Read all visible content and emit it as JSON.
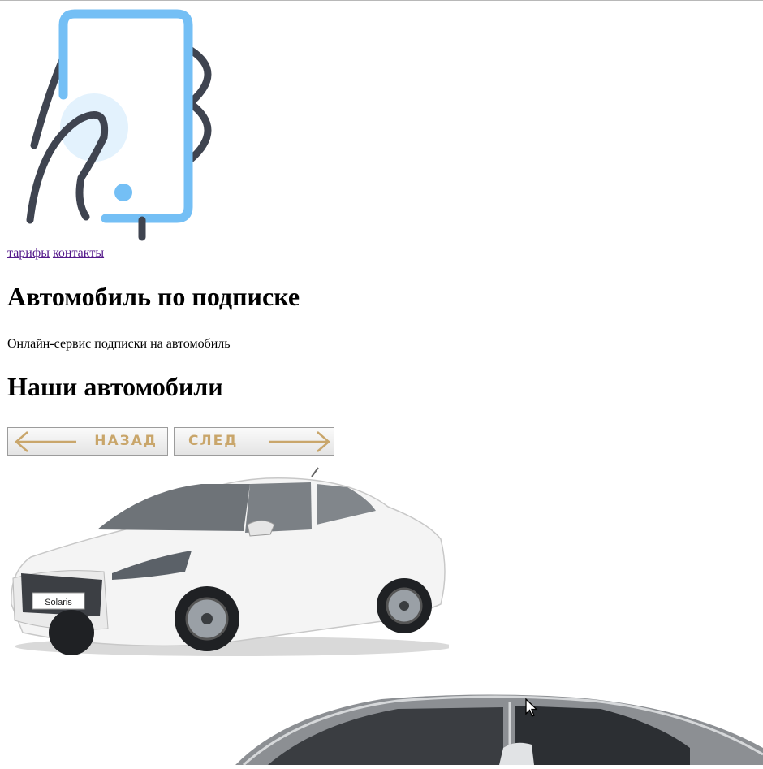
{
  "nav": {
    "links": [
      "тарифы",
      "контакты"
    ]
  },
  "hero": {
    "title": "Автомобиль по подписке",
    "subtitle": "Онлайн-сервис подписки на автомобиль"
  },
  "cars_section": {
    "heading": "Наши автомобили",
    "prev_label": "НАЗАД",
    "next_label": "СЛЕД",
    "car_badge": "Solaris"
  },
  "colors": {
    "logo_blue": "#74bff5",
    "logo_dark": "#3f4450",
    "button_accent": "#c9a66b",
    "link": "#551a8b"
  }
}
